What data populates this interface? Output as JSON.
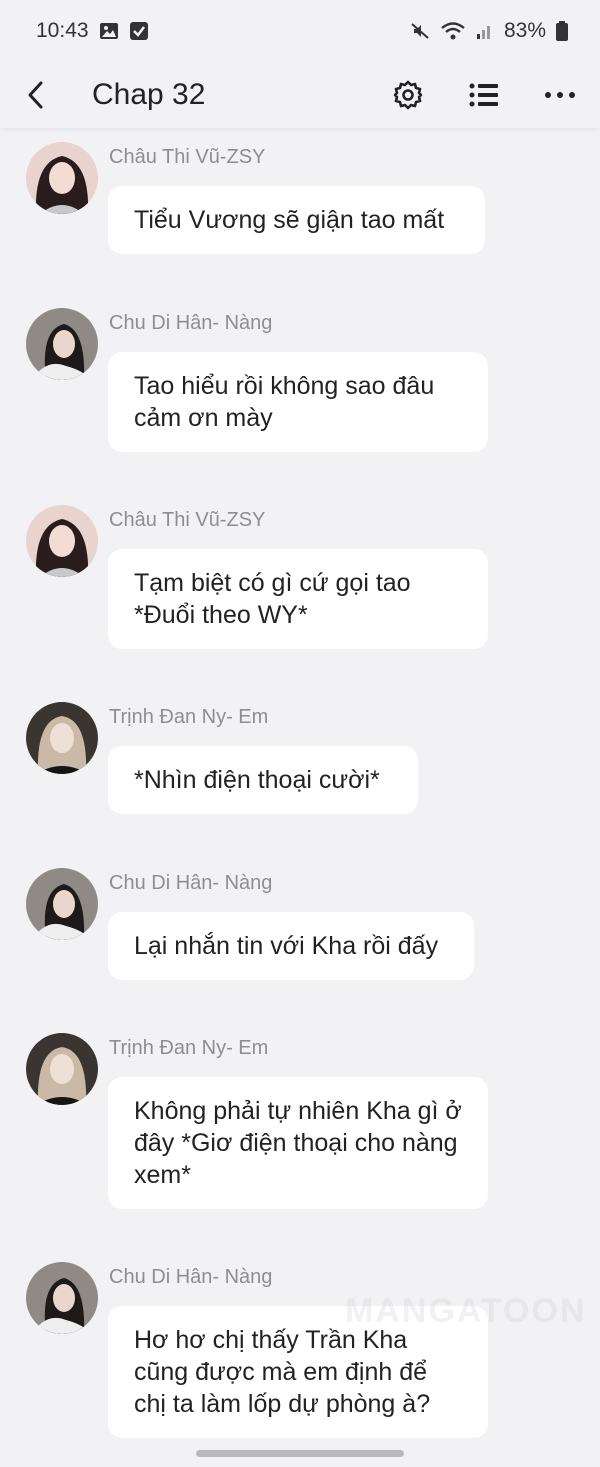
{
  "status": {
    "time": "10:43",
    "battery": "83%"
  },
  "header": {
    "title": "Chap 32"
  },
  "messages": [
    {
      "sender": "Châu Thi Vũ-ZSY",
      "text": "Tiểu Vương sẽ giận tao mất",
      "avatar": "avatar-chau"
    },
    {
      "sender": "Chu Di Hân- Nàng",
      "text": "Tao hiểu rồi không sao đâu cảm ơn mày",
      "avatar": "avatar-chu"
    },
    {
      "sender": "Châu Thi Vũ-ZSY",
      "text": "Tạm biệt có gì cứ gọi tao *Đuổi theo WY*",
      "avatar": "avatar-chau"
    },
    {
      "sender": "Trịnh Đan Ny- Em",
      "text": "*Nhìn điện thoại cười*",
      "avatar": "avatar-trinh"
    },
    {
      "sender": "Chu Di Hân- Nàng",
      "text": "Lại nhắn tin với Kha rồi đấy",
      "avatar": "avatar-chu"
    },
    {
      "sender": "Trịnh Đan Ny- Em",
      "text": "Không phải tự nhiên Kha gì ở đây *Giơ điện thoại cho nàng xem*",
      "avatar": "avatar-trinh"
    },
    {
      "sender": "Chu Di Hân- Nàng",
      "text": "Hơ hơ chị thấy Trần Kha cũng được mà em định để chị ta làm lốp dự phòng à?",
      "avatar": "avatar-chu"
    }
  ],
  "watermark": "MANGATOON"
}
